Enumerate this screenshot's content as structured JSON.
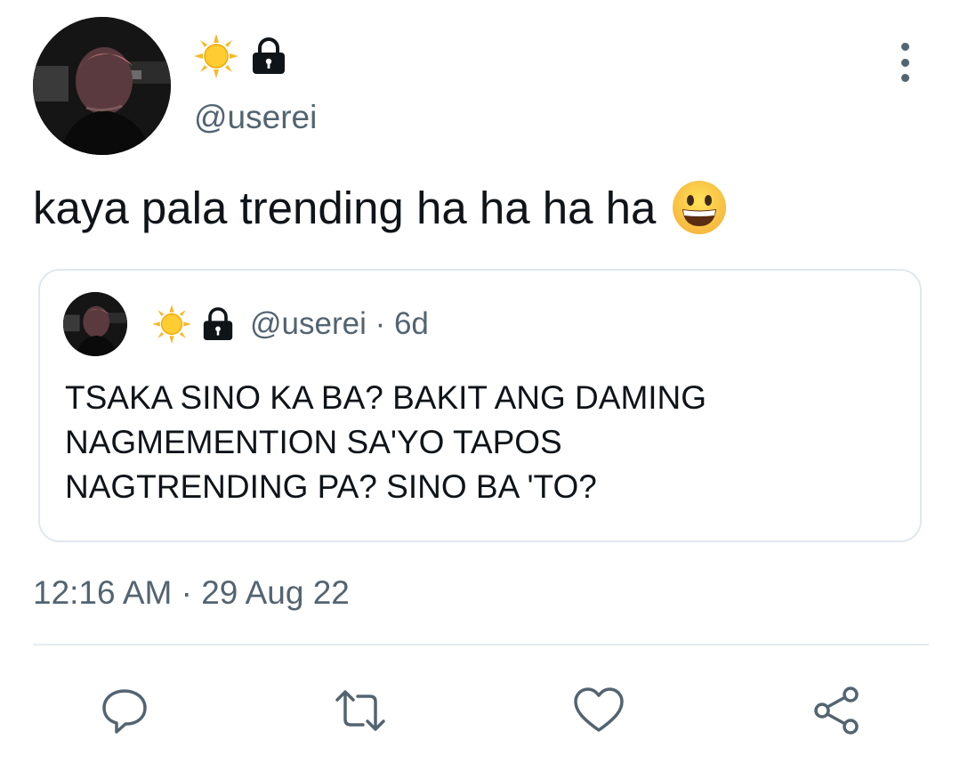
{
  "tweet": {
    "display_name_icons": [
      "sun-emoji",
      "lock-icon"
    ],
    "handle": "@userei",
    "text": "kaya pala trending ha ha ha ha",
    "text_emoji": "grinning-face-emoji",
    "timestamp": "12:16 AM · 29 Aug 22"
  },
  "quoted_tweet": {
    "display_name_icons": [
      "sun-emoji",
      "lock-icon"
    ],
    "handle_and_age": "@userei · 6d",
    "lines": [
      "TSAKA SINO KA BA? BAKIT ANG DAMING",
      "NAGMEMENTION SA'YO TAPOS",
      "NAGTRENDING PA? SINO BA 'TO?"
    ]
  },
  "actions": [
    "reply-icon",
    "retweet-icon",
    "like-icon",
    "share-icon"
  ],
  "colors": {
    "text_primary": "#0f1419",
    "text_secondary": "#536471",
    "border": "#e1e8ed",
    "sun": "#f7b928"
  }
}
